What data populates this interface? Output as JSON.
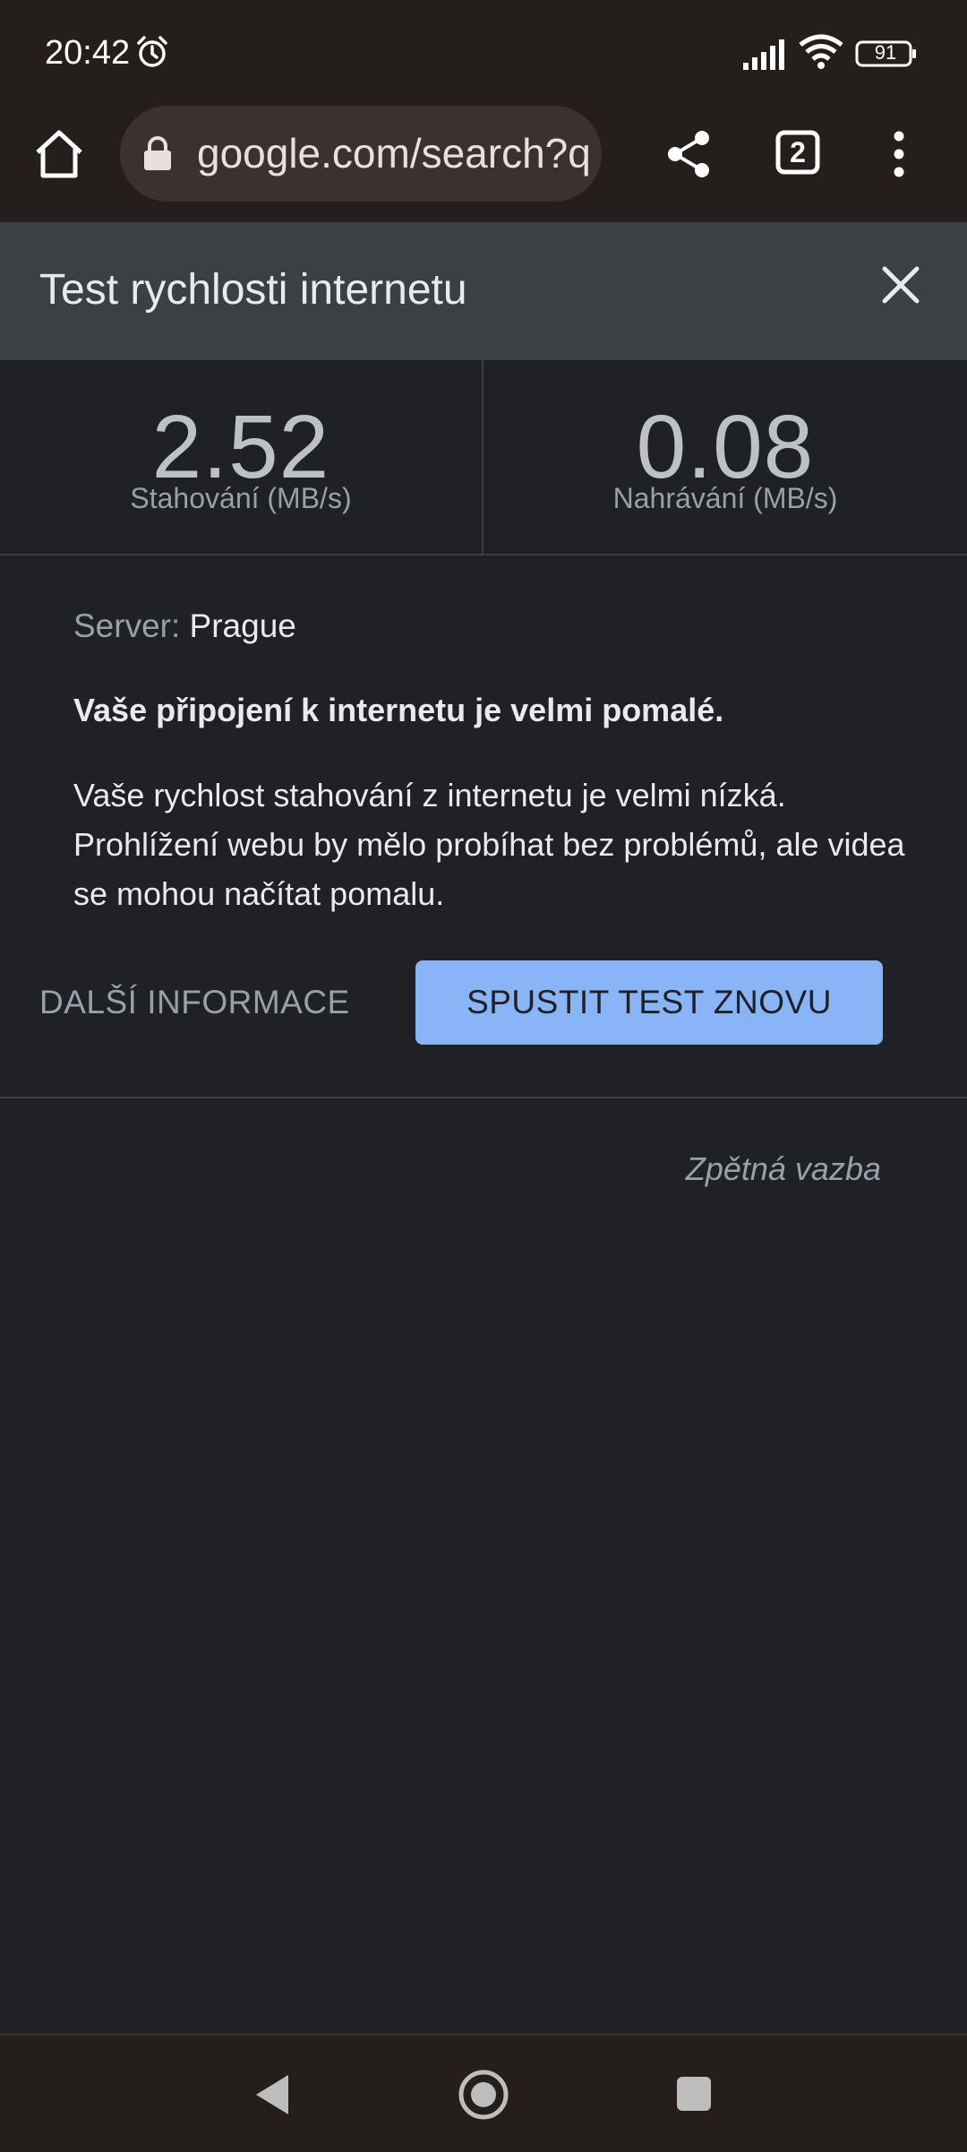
{
  "status_bar": {
    "time": "20:42",
    "battery": "91",
    "icons": [
      "alarm-icon",
      "signal-icon",
      "wifi-icon",
      "battery-icon"
    ]
  },
  "toolbar": {
    "url": "google.com/search?q",
    "tab_count": "2",
    "icons": [
      "home-icon",
      "lock-icon",
      "share-icon",
      "tabs-icon",
      "more-vert-icon"
    ]
  },
  "dialog": {
    "title": "Test rychlosti internetu"
  },
  "results": {
    "download_value": "2.52",
    "download_label": "Stahování (MB/s)",
    "upload_value": "0.08",
    "upload_label": "Nahrávání (MB/s)"
  },
  "info": {
    "server_label": "Server: ",
    "server_value": "Prague",
    "headline": "Vaše připojení k internetu je velmi pomalé.",
    "description": "Vaše rychlost stahování z internetu je velmi nízká. Prohlížení webu by mělo probíhat bez problémů, ale videa se mohou načítat pomalu."
  },
  "actions": {
    "more_info": "DALŠÍ INFORMACE",
    "rerun": "SPUSTIT TEST ZNOVU",
    "feedback": "Zpětná vazba"
  },
  "colors": {
    "accent": "#8ab4f8",
    "background": "#202124",
    "header": "#3c4043",
    "chrome": "#241e1c"
  }
}
